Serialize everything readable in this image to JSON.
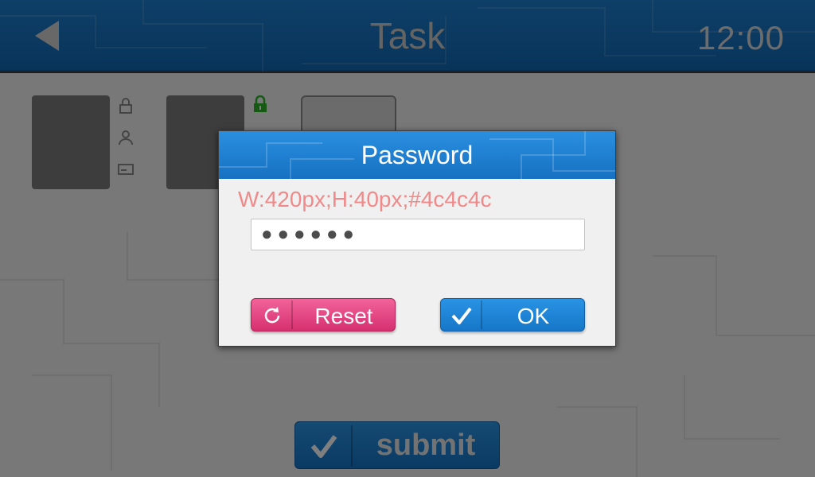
{
  "header": {
    "title": "Task",
    "time": "12:00"
  },
  "footer": {
    "submit_label": "submit"
  },
  "dialog": {
    "title": "Password",
    "note": "W:420px;H:40px;#4c4c4c",
    "password_value": "●●●●●●",
    "reset_label": "Reset",
    "ok_label": "OK"
  },
  "icons": {
    "back": "back-arrow-icon",
    "lock": "lock-icon",
    "unlock": "unlock-icon",
    "user": "user-icon",
    "card": "card-icon",
    "reset": "refresh-icon",
    "ok": "checkmark-icon"
  },
  "colors": {
    "header_blue": "#1d7fd0",
    "reset_pink": "#e0437f",
    "ok_blue": "#1f86d8",
    "note_red": "#f08a8a",
    "lock_green": "#2bb32b",
    "field_text": "#4c4c4c"
  }
}
